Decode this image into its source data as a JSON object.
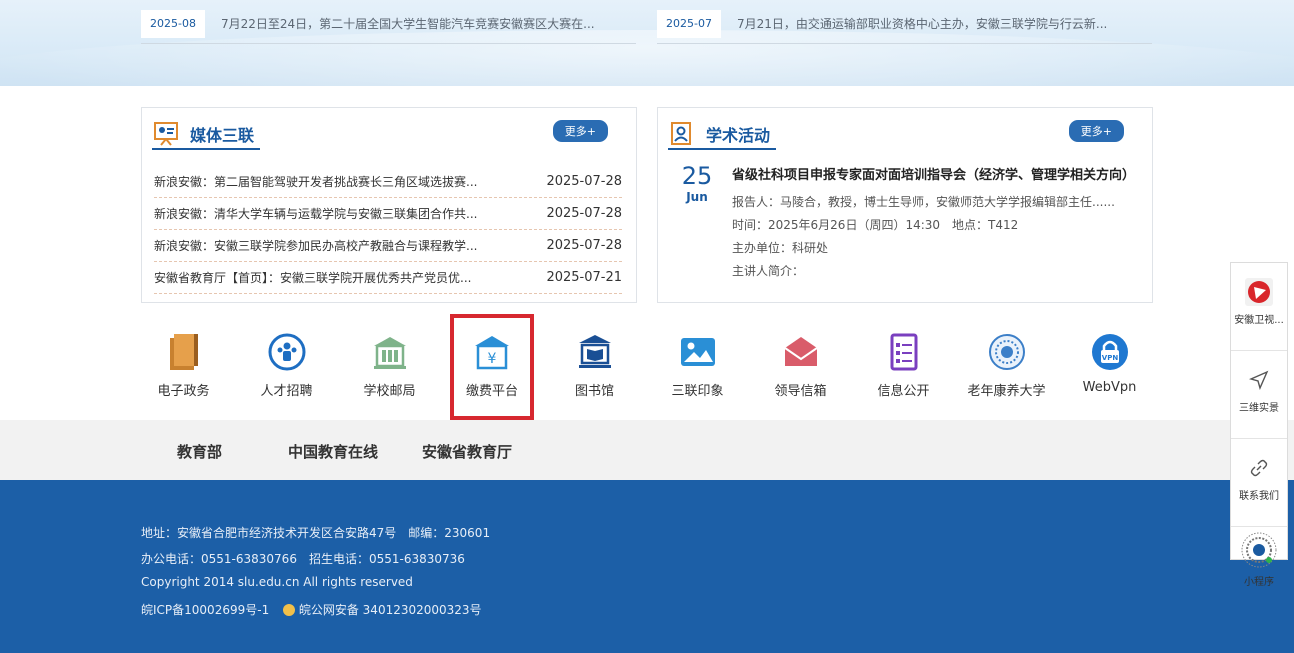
{
  "news": [
    {
      "date": "2025-08",
      "title": "7月22日至24日，第二十届全国大学生智能汽车竞赛安徽赛区大赛在..."
    },
    {
      "date": "2025-07",
      "title": "7月21日，由交通运输部职业资格中心主办，安徽三联学院与行云新..."
    }
  ],
  "media": {
    "title": "媒体三联",
    "more": "更多+",
    "items": [
      {
        "title": "新浪安徽：第二届智能驾驶开发者挑战赛长三角区域选拔赛...",
        "date": "2025-07-28"
      },
      {
        "title": "新浪安徽：清华大学车辆与运载学院与安徽三联集团合作共...",
        "date": "2025-07-28"
      },
      {
        "title": "新浪安徽：安徽三联学院参加民办高校产教融合与课程教学...",
        "date": "2025-07-28"
      },
      {
        "title": "安徽省教育厅【首页】：安徽三联学院开展优秀共产党员优...",
        "date": "2025-07-21"
      }
    ]
  },
  "academic": {
    "title": "学术活动",
    "more": "更多+",
    "day": "25",
    "month": "Jun",
    "headline": "省级社科项目申报专家面对面培训指导会（经济学、管理学相关方向）",
    "lines": [
      "报告人：马陵合，教授，博士生导师，安徽师范大学学报编辑部主任......",
      "时间：2025年6月26日（周四）14:30　地点：T412",
      "主办单位：科研处",
      "主讲人简介："
    ]
  },
  "quick_links": [
    {
      "label": "电子政务",
      "icon": "books-icon"
    },
    {
      "label": "人才招聘",
      "icon": "people-icon"
    },
    {
      "label": "学校邮局",
      "icon": "building-icon"
    },
    {
      "label": "缴费平台",
      "icon": "payment-icon"
    },
    {
      "label": "图书馆",
      "icon": "library-icon"
    },
    {
      "label": "三联印象",
      "icon": "picture-icon"
    },
    {
      "label": "领导信箱",
      "icon": "envelope-icon"
    },
    {
      "label": "信息公开",
      "icon": "document-icon"
    },
    {
      "label": "老年康养大学",
      "icon": "emblem-icon"
    },
    {
      "label": "WebVpn",
      "icon": "vpn-icon"
    }
  ],
  "friend_links": [
    "教育部",
    "中国教育在线",
    "安徽省教育厅"
  ],
  "footer": {
    "address": "地址：安徽省合肥市经济技术开发区合安路47号　邮编：230601",
    "phone": "办公电话：0551-63830766　招生电话：0551-63830736",
    "copyright": "Copyright 2014 slu.edu.cn All rights reserved",
    "icp": "皖ICP备10002699号-1",
    "police": "皖公网安备 34012302000323号"
  },
  "float_bar": [
    {
      "label": "安徽卫视...",
      "icon": "tv-logo-icon"
    },
    {
      "label": "三维实景",
      "icon": "navigation-icon"
    },
    {
      "label": "联系我们",
      "icon": "link-icon"
    },
    {
      "label": "小程序",
      "icon": "qr-code-icon"
    }
  ],
  "colors": {
    "accent": "#1a5aa0",
    "footer": "#1c5fa7",
    "highlight": "#d7282f"
  }
}
